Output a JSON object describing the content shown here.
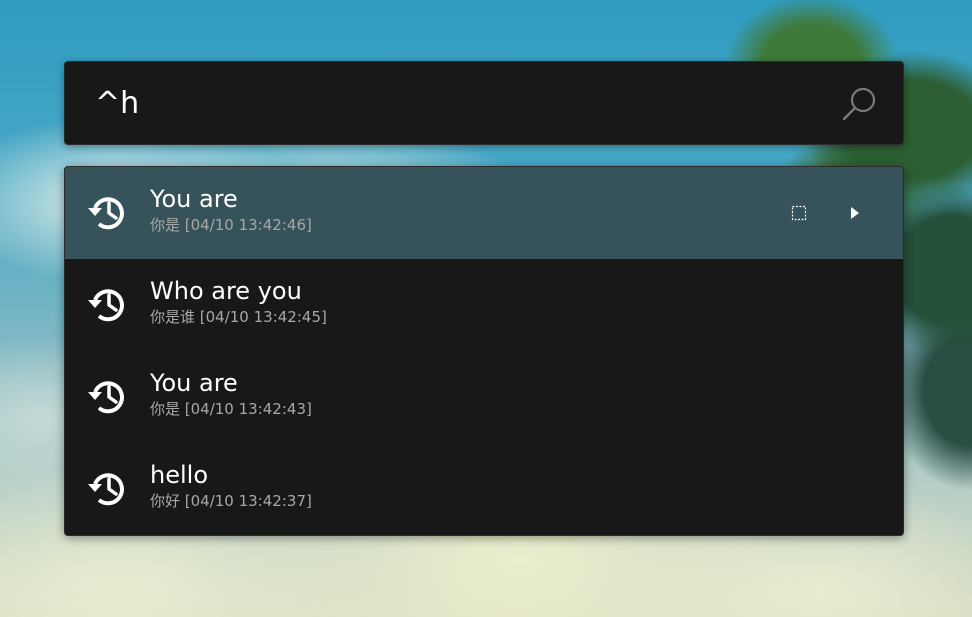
{
  "search": {
    "query": "^h",
    "icon": "search-icon"
  },
  "results": [
    {
      "title": "You are",
      "subtitle": "你是 [04/10 13:42:46]",
      "icon": "history-icon",
      "selected": true
    },
    {
      "title": "Who are you",
      "subtitle": "你是谁 [04/10 13:42:45]",
      "icon": "history-icon",
      "selected": false
    },
    {
      "title": "You are",
      "subtitle": "你是 [04/10 13:42:43]",
      "icon": "history-icon",
      "selected": false
    },
    {
      "title": "hello",
      "subtitle": "你好 [04/10 13:42:37]",
      "icon": "history-icon",
      "selected": false
    }
  ],
  "colors": {
    "panel_background": "#181818",
    "selected_row": "#36525a",
    "primary_text": "#ffffff",
    "secondary_text": "#a8a8a8"
  }
}
